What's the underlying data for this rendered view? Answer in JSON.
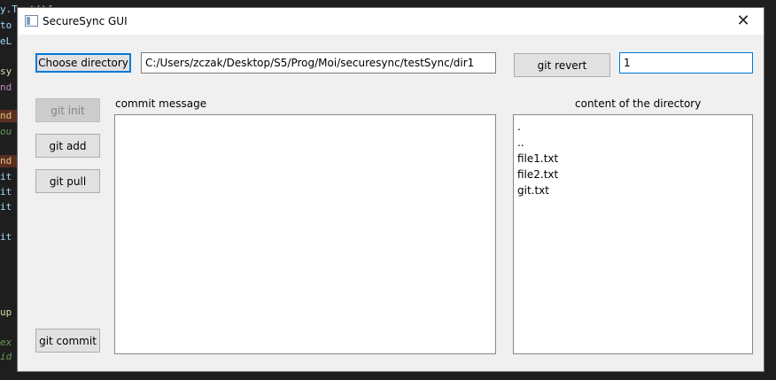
{
  "window": {
    "title": "SecureSync GUI",
    "close_symbol": "✕"
  },
  "toolbar": {
    "choose_directory_label": "Choose directory",
    "directory_path": "C:/Users/zczak/Desktop/S5/Prog/Moi/securesync/testSync/dir1",
    "git_revert_label": "git revert",
    "revert_value": "1"
  },
  "actions": {
    "git_init_label": "git init",
    "git_add_label": "git add",
    "git_pull_label": "git pull",
    "git_commit_label": "git commit"
  },
  "commit": {
    "label": "commit message",
    "value": ""
  },
  "directory": {
    "label": "content of the directory",
    "items": [
      ".",
      "..",
      "file1.txt",
      "file2.txt",
      "git.txt"
    ]
  },
  "background_editor": {
    "lines": [
      "y.Text(){",
      "to",
      "eL",
      "",
      "sy                                                                                                                                       at",
      "nd",
      "",
      "",
      "nd",
      "ou",
      "",
      "nd",
      "it",
      "it",
      "it",
      "",
      "",
      "it",
      "",
      "",
      "",
      "",
      "",
      "",
      "up",
      "",
      "ex",
      "id"
    ]
  },
  "colors": {
    "accent": "#0078d7",
    "window_bg": "#f0f0f0",
    "editor_bg": "#1e1e1e"
  }
}
